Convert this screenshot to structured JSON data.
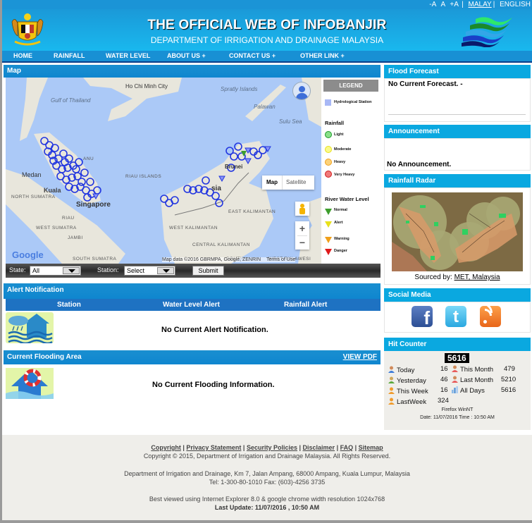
{
  "top_links": {
    "font_smaller": "-A",
    "font_normal": "A",
    "font_larger": "+A",
    "separator": "|",
    "lang_malay": "MALAY",
    "lang_english": "ENGLISH"
  },
  "header": {
    "title": "THE OFFICIAL WEB OF INFOBANJIR",
    "subtitle": "DEPARTMENT OF IRRIGATION AND DRAINAGE MALAYSIA"
  },
  "nav": [
    {
      "label": "HOME"
    },
    {
      "label": "RAINFALL"
    },
    {
      "label": "WATER LEVEL"
    },
    {
      "label": "ABOUT US  +"
    },
    {
      "label": "CONTACT US  +"
    },
    {
      "label": "OTHER LINK  +"
    }
  ],
  "map_panel": {
    "title": "Map",
    "labels": {
      "ho_chi_minh": "Ho Chi Minh City",
      "gulf": "Gulf of Thailand",
      "spratly": "Spratly Islands",
      "palawan": "Palawan",
      "sulu_sea": "Sulu Sea",
      "terengganu": "ANU",
      "medan": "Medan",
      "riau_islands": "RIAU ISLANDS",
      "kuala": "Kuala",
      "north_sumatra": "NORTH SUMATRA",
      "singapore": "Singapore",
      "riau": "RIAU",
      "west_sumatra": "WEST SUMATRA",
      "jambi": "JAMBI",
      "south_sumatra": "SOUTH SUMATRA",
      "brunei": "Brunei",
      "malaysia": "sia",
      "west_kalimantan": "WEST KALIMANTAN",
      "east_kalimantan": "EAST KALIMANTAN",
      "central_kalimantan": "CENTRAL KALIMANTAN",
      "south": "SOUTH",
      "west_sulawesi": "WEST SULAWESI"
    },
    "map_type_map": "Map",
    "map_type_satellite": "Satellite",
    "zoom_in": "+",
    "zoom_out": "−",
    "google": "Google",
    "attribution": "Map data ©2016 GBRMPA, Google, ZENRIN",
    "terms": "Terms of Use",
    "legend": {
      "title": "LEGEND",
      "hydro_station": "Hydrological Station",
      "rainfall_heading": "Rainfall",
      "rainfall": [
        {
          "label": "Light",
          "color": "#2fbf3a"
        },
        {
          "label": "Moderate",
          "color": "#f4ef1a"
        },
        {
          "label": "Heavy",
          "color": "#f4b21f"
        },
        {
          "label": "Very Heavy",
          "color": "#e8262b"
        }
      ],
      "water_heading": "River Water Level",
      "water": [
        {
          "label": "Normal",
          "color": "#3e9e2c"
        },
        {
          "label": "Alert",
          "color": "#e8e11a"
        },
        {
          "label": "Warning",
          "color": "#f0a01a"
        },
        {
          "label": "Danger",
          "color": "#e01a1a"
        }
      ]
    }
  },
  "filters": {
    "state_label": "State:",
    "state_value": "All",
    "station_label": "Station:",
    "station_value": "Select",
    "submit": "Submit"
  },
  "alert": {
    "title": "Alert Notification",
    "columns": [
      "Station",
      "Water Level Alert",
      "Rainfall Alert"
    ],
    "message": "No Current Alert Notification."
  },
  "flooding": {
    "title": "Current Flooding Area",
    "view_pdf": "VIEW PDF",
    "message": "No Current Flooding Information."
  },
  "flood_forecast": {
    "title": "Flood Forecast",
    "message": "No Current Forecast. -"
  },
  "announcement": {
    "title": "Announcement",
    "message": "No Announcement."
  },
  "radar": {
    "title": "Rainfall Radar",
    "source_label": "Sourced by:",
    "source_link": "MET, Malaysia"
  },
  "social": {
    "title": "Social Media",
    "items": [
      "facebook",
      "twitter",
      "rss"
    ]
  },
  "hit_counter": {
    "title": "Hit Counter",
    "total": "5616",
    "today_label": "Today",
    "today": "16",
    "yesterday_label": "Yesterday",
    "yesterday": "46",
    "this_week_label": "This Week",
    "this_week": "16",
    "last_week_label": "LastWeek",
    "last_week": "324",
    "this_month_label": "This Month",
    "this_month": "479",
    "last_month_label": "Last Month",
    "last_month": "5210",
    "all_days_label": "All Days",
    "all_days": "5616",
    "browser": "Firefox WinNT",
    "datetime": "Date: 11/07/2016 Time : 10:50 AM"
  },
  "footer": {
    "links": [
      "Copyright",
      "Privacy Statement",
      "Security Policies",
      "Disclaimer",
      "FAQ",
      "Sitemap"
    ],
    "separator": " | ",
    "copyright": "Copyright © 2015, Department of Irrigation and Drainage Malaysia. All Rights Reserved.",
    "address": "Department of Irrigation and Drainage, Km 7, Jalan Ampang, 68000 Ampang, Kuala Lumpur, Malaysia",
    "contact": "Tel: 1-300-80-1010 Fax: (603)-4256 3735",
    "best_viewed": "Best viewed using Internet Explorer 8.0 & google chrome width resolution 1024x768",
    "last_update": "Last Update: 11/07/2016 , 10:50 AM"
  }
}
